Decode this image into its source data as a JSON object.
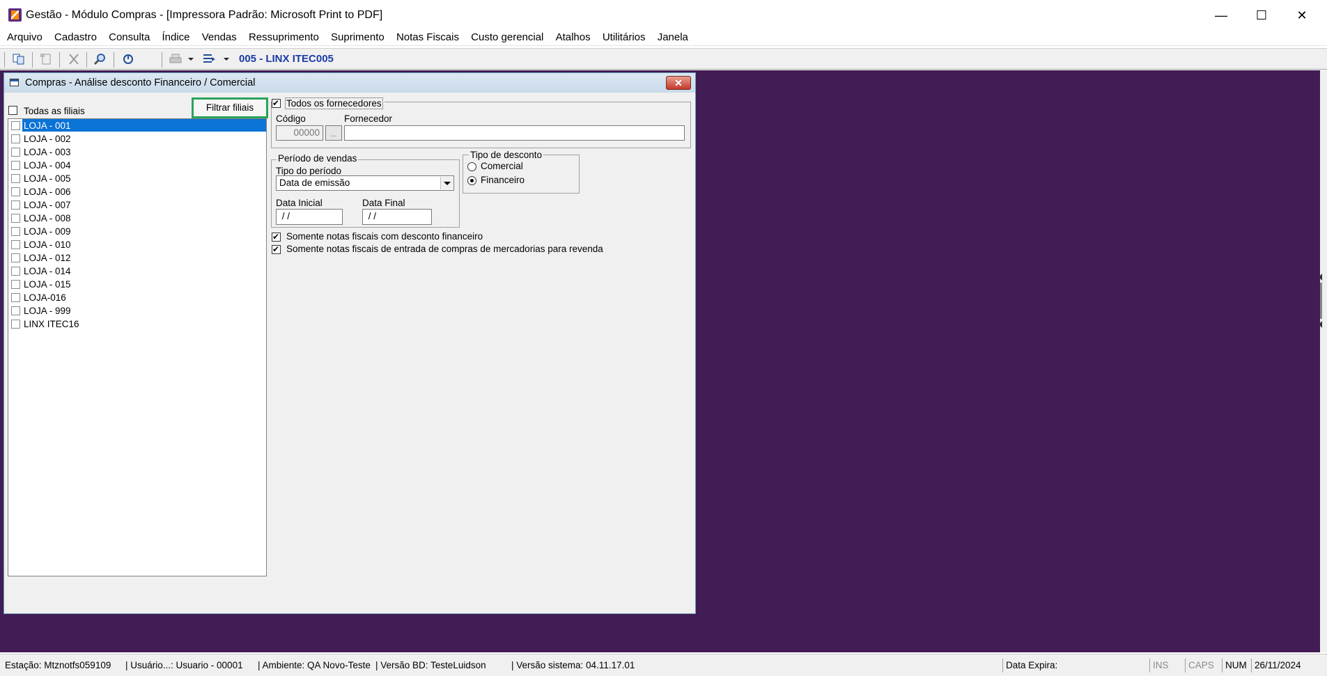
{
  "window": {
    "title": "Gestão  - Módulo Compras - [Impressora Padrão: Microsoft Print to PDF]",
    "minimize": "—",
    "maximize": "☐",
    "close": "✕"
  },
  "menu": [
    "Arquivo",
    "Cadastro",
    "Consulta",
    "Índice",
    "Vendas",
    "Ressuprimento",
    "Suprimento",
    "Notas Fiscais",
    "Custo gerencial",
    "Atalhos",
    "Utilitários",
    "Janela"
  ],
  "toolbar": {
    "store_label": "005 - LINX ITEC005",
    "icons": [
      "copy-icon",
      "new-document-icon",
      "delete-icon",
      "search-icon",
      "power-icon",
      "print-icon",
      "dropdown-arrow-icon",
      "export-icon",
      "dropdown-arrow-icon"
    ]
  },
  "child_window": {
    "title": "Compras - Análise desconto Financeiro / Comercial",
    "close": "✕"
  },
  "branches": {
    "all_label": "Todas as filiais",
    "all_checked": false,
    "filter_button": "Filtrar filiais",
    "items": [
      {
        "label": "LOJA - 001",
        "selected": true
      },
      {
        "label": "LOJA - 002"
      },
      {
        "label": "LOJA - 003"
      },
      {
        "label": "LOJA - 004"
      },
      {
        "label": "LOJA - 005"
      },
      {
        "label": "LOJA - 006"
      },
      {
        "label": "LOJA - 007"
      },
      {
        "label": "LOJA - 008"
      },
      {
        "label": "LOJA - 009"
      },
      {
        "label": "LOJA - 010"
      },
      {
        "label": "LOJA - 012"
      },
      {
        "label": "LOJA - 014"
      },
      {
        "label": "LOJA - 015"
      },
      {
        "label": "LOJA-016"
      },
      {
        "label": "LOJA - 999"
      },
      {
        "label": "LINX ITEC16"
      }
    ]
  },
  "supplier": {
    "all_label": "Todos os fornecedores",
    "all_checked": true,
    "code_label": "Código",
    "code_value": "00000",
    "lookup_label": "...",
    "name_label": "Fornecedor",
    "name_value": ""
  },
  "period": {
    "group_label": "Período de vendas",
    "type_label": "Tipo do período",
    "type_value": "Data de emissão",
    "start_label": "Data Inicial",
    "start_value": " / /",
    "end_label": "Data Final",
    "end_value": " / /"
  },
  "discount": {
    "group_label": "Tipo de desconto",
    "options": [
      {
        "label": "Comercial",
        "checked": false
      },
      {
        "label": "Financeiro",
        "checked": true
      }
    ]
  },
  "filters": {
    "only_financial_discount": "Somente notas fiscais com desconto financeiro",
    "only_purchase_for_resale": "Somente notas fiscais de entrada de compras de mercadorias para revenda"
  },
  "status": {
    "station": "Estação: Mtznotfs059109",
    "user": "| Usuário...: Usuario - 00001",
    "environment": "| Ambiente: QA Novo-Teste",
    "db_version": "| Versão BD: TesteLuidson",
    "system_version": "| Versão sistema: 04.11.17.01",
    "expiry": "Data Expira:",
    "ins": "INS",
    "caps": "CAPS",
    "num": "NUM",
    "date": "26/11/2024"
  },
  "colors": {
    "workspace": "#421c55",
    "selection": "#0a73d6",
    "store_label": "#1a3ca8",
    "highlight_border": "#2aa35a"
  }
}
